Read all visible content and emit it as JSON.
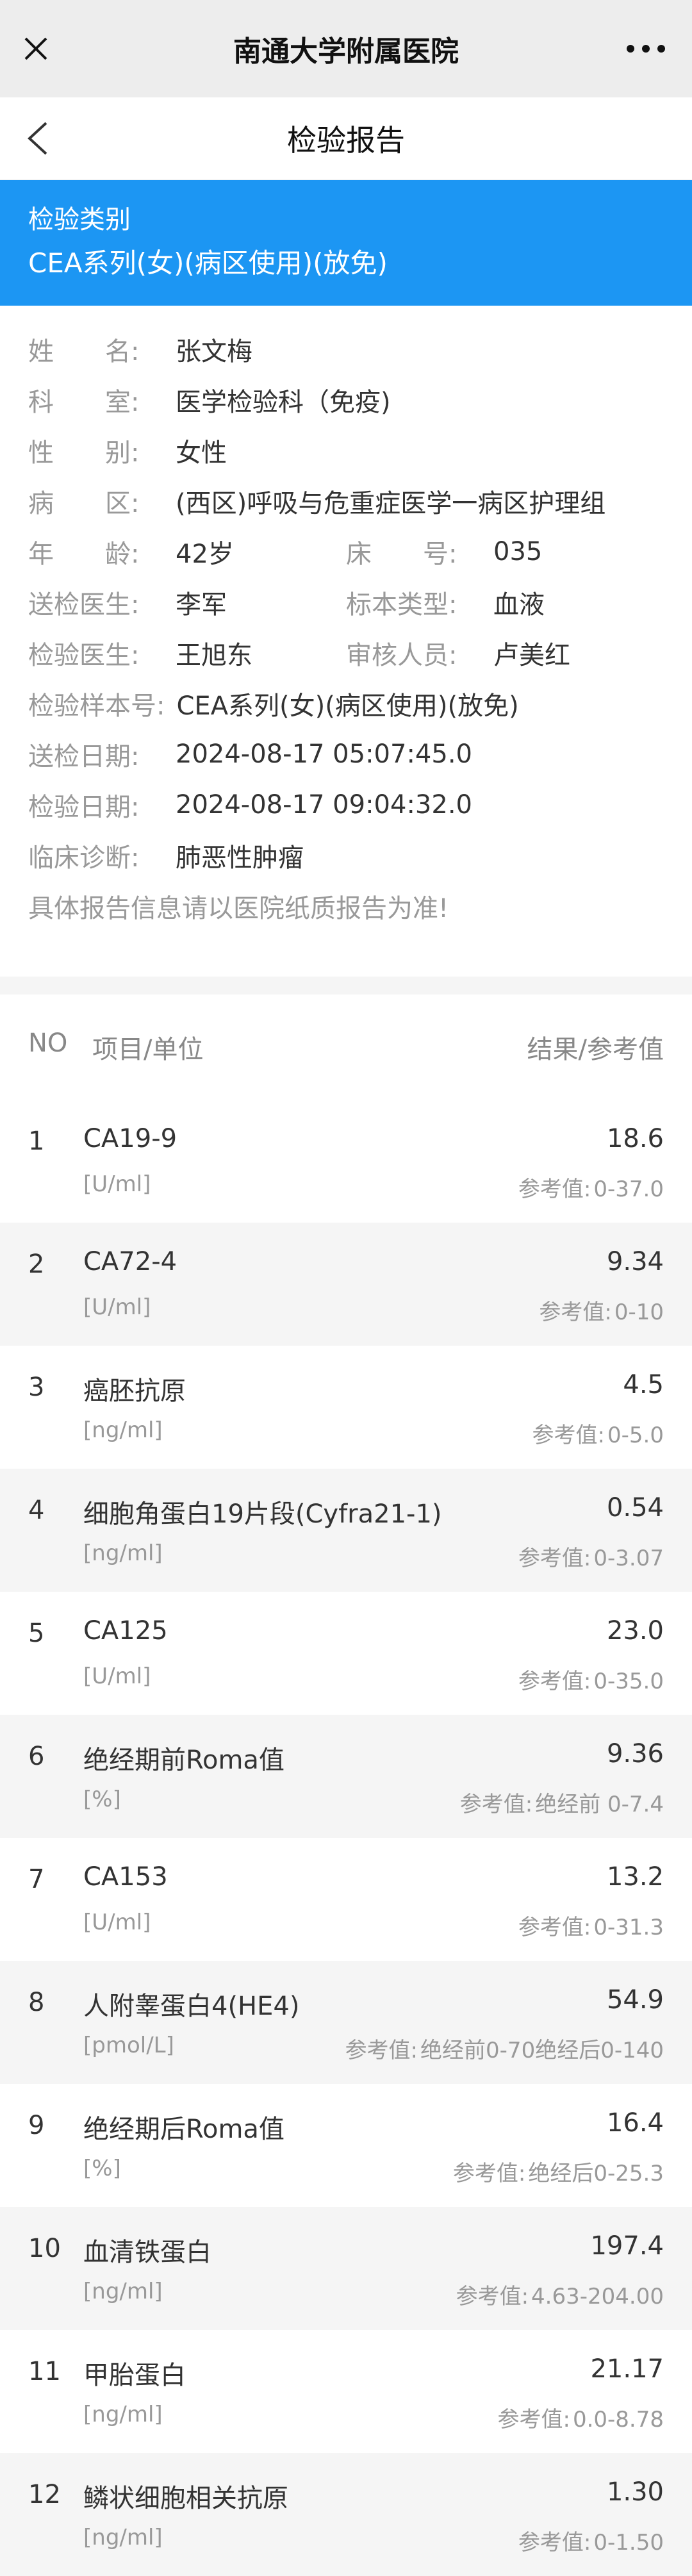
{
  "app": {
    "title": "南通大学附属医院",
    "page_title": "检验报告"
  },
  "category": {
    "label": "检验类别",
    "value": "CEA系列(女)(病区使用)(放免)"
  },
  "patient": {
    "name_label": "姓　　名:",
    "name": "张文梅",
    "dept_label": "科　　室:",
    "dept": "医学检验科（免疫)",
    "gender_label": "性　　别:",
    "gender": "女性",
    "ward_label": "病　　区:",
    "ward": "(西区)呼吸与危重症医学一病区护理组",
    "age_label": "年　　龄:",
    "age": "42岁",
    "bed_label": "床　　号:",
    "bed": "035",
    "sender_label": "送检医生:",
    "sender": "李军",
    "sample_type_label": "标本类型:",
    "sample_type": "血液",
    "tester_label": "检验医生:",
    "tester": "王旭东",
    "reviewer_label": "审核人员:",
    "reviewer": "卢美红",
    "sample_no_label": "检验样本号:",
    "sample_no": "CEA系列(女)(病区使用)(放免)",
    "send_date_label": "送检日期:",
    "send_date": "2024-08-17 05:07:45.0",
    "test_date_label": "检验日期:",
    "test_date": "2024-08-17 09:04:32.0",
    "diagnosis_label": "临床诊断:",
    "diagnosis": "肺恶性肿瘤",
    "note": "具体报告信息请以医院纸质报告为准!"
  },
  "table": {
    "col_no": "NO",
    "col_item": "项目/单位",
    "col_result": "结果/参考值",
    "ref_label": "参考值:",
    "rows": [
      {
        "no": "1",
        "name": "CA19-9",
        "unit": "[U/ml]",
        "result": "18.6",
        "ref": "0-37.0"
      },
      {
        "no": "2",
        "name": "CA72-4",
        "unit": "[U/ml]",
        "result": "9.34",
        "ref": "0-10"
      },
      {
        "no": "3",
        "name": "癌胚抗原",
        "unit": "[ng/ml]",
        "result": "4.5",
        "ref": "0-5.0"
      },
      {
        "no": "4",
        "name": "细胞角蛋白19片段(Cyfra21-1)",
        "unit": "[ng/ml]",
        "result": "0.54",
        "ref": "0-3.07"
      },
      {
        "no": "5",
        "name": "CA125",
        "unit": "[U/ml]",
        "result": "23.0",
        "ref": "0-35.0"
      },
      {
        "no": "6",
        "name": "绝经期前Roma值",
        "unit": "[%]",
        "result": "9.36",
        "ref": "绝经前 0-7.4"
      },
      {
        "no": "7",
        "name": "CA153",
        "unit": "[U/ml]",
        "result": "13.2",
        "ref": "0-31.3"
      },
      {
        "no": "8",
        "name": "人附睾蛋白4(HE4)",
        "unit": "[pmol/L]",
        "result": "54.9",
        "ref": "绝经前0-70绝经后0-140"
      },
      {
        "no": "9",
        "name": "绝经期后Roma值",
        "unit": "[%]",
        "result": "16.4",
        "ref": "绝经后0-25.3"
      },
      {
        "no": "10",
        "name": "血清铁蛋白",
        "unit": "[ng/ml]",
        "result": "197.4",
        "ref": "4.63-204.00"
      },
      {
        "no": "11",
        "name": "甲胎蛋白",
        "unit": "[ng/ml]",
        "result": "21.17",
        "ref": "0.0-8.78"
      },
      {
        "no": "12",
        "name": "鳞状细胞相关抗原",
        "unit": "[ng/ml]",
        "result": "1.30",
        "ref": "0-1.50"
      }
    ]
  }
}
